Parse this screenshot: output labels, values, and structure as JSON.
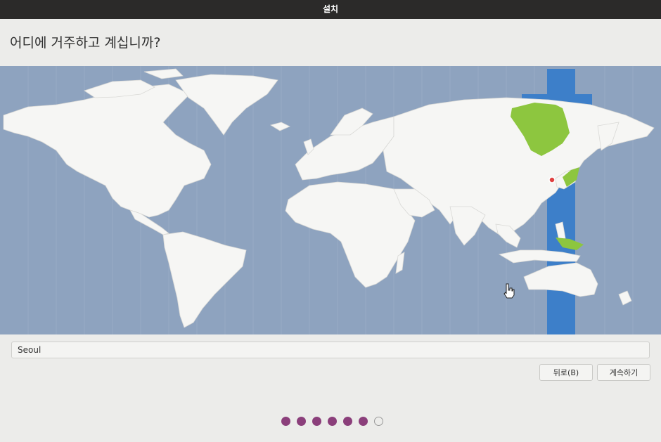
{
  "window": {
    "title": "설치"
  },
  "page": {
    "heading": "어디에 거주하고 계십니까?"
  },
  "map": {
    "selected_city": "Seoul",
    "ocean_color": "#8ea3bf",
    "land_color": "#f6f6f4",
    "timezone_band_color": "#3d7fc9",
    "highlight_color": "#8dc63f",
    "marker_color": "#e04040"
  },
  "timezone": {
    "value": "Seoul"
  },
  "buttons": {
    "back_label": "뒤로(B)",
    "continue_label": "계속하기"
  },
  "progress": {
    "total_steps": 7,
    "completed_steps": 6,
    "filled_color": "#8b3f7b"
  }
}
